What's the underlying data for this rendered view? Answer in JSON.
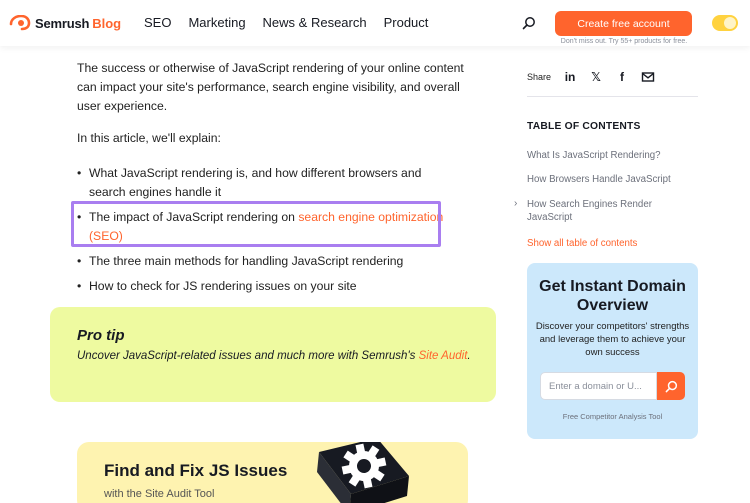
{
  "header": {
    "logo_name": "Semrush",
    "logo_suffix": "Blog",
    "nav": [
      "SEO",
      "Marketing",
      "News & Research",
      "Product"
    ],
    "cta_label": "Create free account",
    "cta_note": "Don't miss out. Try 55+ products for free."
  },
  "article": {
    "intro": "The success or otherwise of JavaScript rendering of your online content can impact your site's performance, search engine visibility, and overall user experience.",
    "explain": "In this article, we'll explain:",
    "bullets": {
      "b1": "What JavaScript rendering is, and how different browsers and search engines handle it",
      "b2_prefix": "The impact of JavaScript rendering on ",
      "b2_link": "search engine optimization (SEO)",
      "b3": "The three main methods for handling JavaScript rendering",
      "b4": "How to check for JS rendering issues on your site"
    },
    "protip": {
      "title": "Pro tip",
      "text_prefix": "Uncover JavaScript-related issues and much more with Semrush's ",
      "link": "Site Audit",
      "text_suffix": "."
    },
    "promo": {
      "title": "Find and Fix JS Issues",
      "subtitle": "with the Site Audit Tool"
    }
  },
  "sidebar": {
    "share_label": "Share",
    "share_icons": [
      "linkedin-icon",
      "x-icon",
      "facebook-icon",
      "email-icon"
    ],
    "toc_title": "TABLE OF CONTENTS",
    "toc_items": [
      "What Is JavaScript Rendering?",
      "How Browsers Handle JavaScript",
      "How Search Engines Render JavaScript"
    ],
    "toc_more": "Show all table of contents",
    "widget": {
      "title": "Get Instant Domain Overview",
      "desc": "Discover your competitors' strengths and leverage them to achieve your own success",
      "placeholder": "Enter a domain or U...",
      "foot": "Free Competitor Analysis Tool"
    }
  },
  "colors": {
    "accent": "#ff642d",
    "highlight_border": "#a97ef0",
    "protip_bg": "#eefaa0",
    "widget_bg": "#cce8fb",
    "toggle": "#ffd23f"
  }
}
